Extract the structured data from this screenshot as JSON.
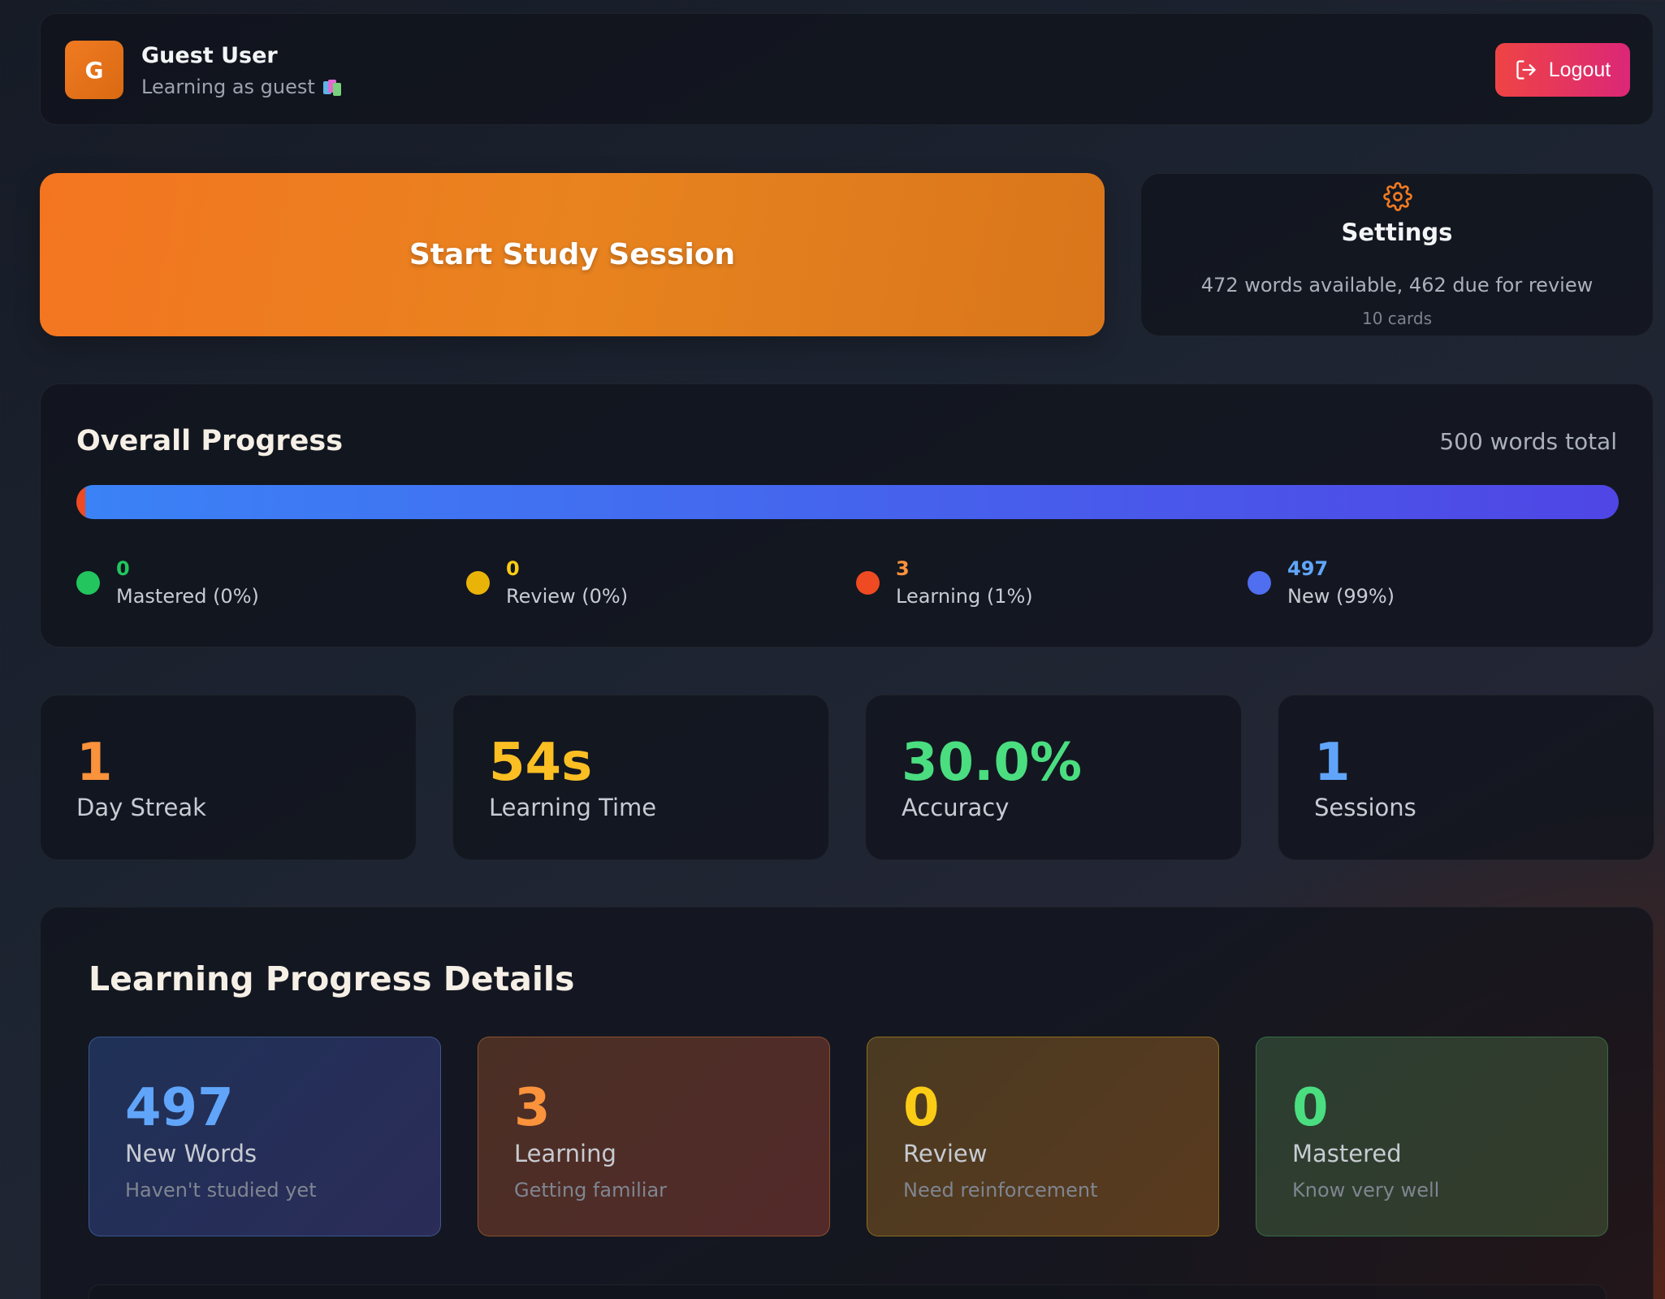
{
  "header": {
    "avatar_letter": "G",
    "user_name": "Guest User",
    "user_subtitle": "Learning as guest",
    "subtitle_icon": "books-icon",
    "logout_label": "Logout",
    "logout_icon": "logout-icon"
  },
  "start_button": {
    "label": "Start Study Session"
  },
  "settings": {
    "icon": "gear-icon",
    "title": "Settings",
    "description": "472 words available, 462 due for review",
    "cards": "10 cards"
  },
  "overall_progress": {
    "title": "Overall Progress",
    "total": "500 words total",
    "bar": [
      {
        "name": "mastered",
        "fraction": 0.0,
        "color": "#22c55e"
      },
      {
        "name": "review",
        "fraction": 0.0,
        "color": "#eab308"
      },
      {
        "name": "learning",
        "fraction": 0.006,
        "color": "#ef4a22"
      },
      {
        "name": "new",
        "fraction": 0.994,
        "color": "#3b82f6"
      }
    ],
    "legend": [
      {
        "value": "0",
        "label": "Mastered (0%)",
        "color": "#22c55e",
        "dot": "#22c55e"
      },
      {
        "value": "0",
        "label": "Review (0%)",
        "color": "#facc15",
        "dot": "#eab308"
      },
      {
        "value": "3",
        "label": "Learning (1%)",
        "color": "#fb923c",
        "dot": "#ef4a22"
      },
      {
        "value": "497",
        "label": "New (99%)",
        "color": "#60a5fa",
        "dot": "#4f6ef0"
      }
    ]
  },
  "stats": [
    {
      "value": "1",
      "label": "Day Streak",
      "color": "#fb923c"
    },
    {
      "value": "54s",
      "label": "Learning Time",
      "color": "#fbbf24"
    },
    {
      "value": "30.0%",
      "label": "Accuracy",
      "color": "#4ade80"
    },
    {
      "value": "1",
      "label": "Sessions",
      "color": "#60a5fa"
    }
  ],
  "details": {
    "title": "Learning Progress Details",
    "cards": [
      {
        "value": "497",
        "label": "New Words",
        "sub": "Haven't studied yet",
        "color": "#60a5fa"
      },
      {
        "value": "3",
        "label": "Learning",
        "sub": "Getting familiar",
        "color": "#fb923c"
      },
      {
        "value": "0",
        "label": "Review",
        "sub": "Need reinforcement",
        "color": "#facc15"
      },
      {
        "value": "0",
        "label": "Mastered",
        "sub": "Know very well",
        "color": "#4ade80"
      }
    ]
  }
}
